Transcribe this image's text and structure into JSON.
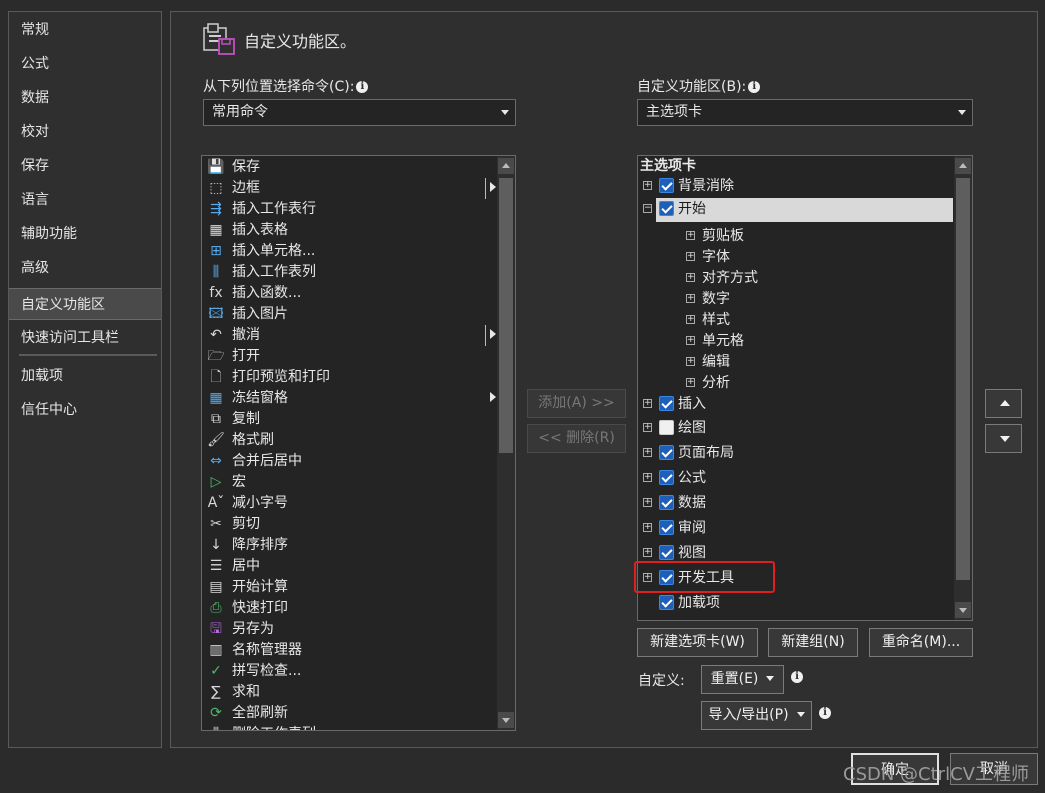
{
  "nav": {
    "items": [
      {
        "label": "常规"
      },
      {
        "label": "公式"
      },
      {
        "label": "数据"
      },
      {
        "label": "校对"
      },
      {
        "label": "保存"
      },
      {
        "label": "语言"
      },
      {
        "label": "辅助功能"
      },
      {
        "label": "高级"
      },
      {
        "label": "自定义功能区"
      },
      {
        "label": "快速访问工具栏"
      },
      {
        "label": "加载项"
      },
      {
        "label": "信任中心"
      }
    ],
    "selected_index": 8
  },
  "header": {
    "title": "自定义功能区。"
  },
  "left": {
    "label": "从下列位置选择命令(C):",
    "combo_value": "常用命令",
    "commands": [
      {
        "label": "保存",
        "icon": "save-icon",
        "glyph": "💾"
      },
      {
        "label": "边框",
        "icon": "border-icon",
        "glyph": "⬚",
        "submenu": true
      },
      {
        "label": "插入工作表行",
        "icon": "insert-row-icon",
        "glyph": "⇶"
      },
      {
        "label": "插入表格",
        "icon": "table-icon",
        "glyph": "▦"
      },
      {
        "label": "插入单元格...",
        "icon": "insert-cells-icon",
        "glyph": "⊞"
      },
      {
        "label": "插入工作表列",
        "icon": "insert-column-icon",
        "glyph": "⫼"
      },
      {
        "label": "插入函数...",
        "icon": "function-icon",
        "glyph": "fx"
      },
      {
        "label": "插入图片",
        "icon": "picture-icon",
        "glyph": "🖾"
      },
      {
        "label": "撤消",
        "icon": "undo-icon",
        "glyph": "↶",
        "submenu": true
      },
      {
        "label": "打开",
        "icon": "open-folder-icon",
        "glyph": "🗁"
      },
      {
        "label": "打印预览和打印",
        "icon": "print-preview-icon",
        "glyph": "🗋"
      },
      {
        "label": "冻结窗格",
        "icon": "freeze-panes-icon",
        "glyph": "▦",
        "submenu_arrow": true
      },
      {
        "label": "复制",
        "icon": "copy-icon",
        "glyph": "⧉"
      },
      {
        "label": "格式刷",
        "icon": "format-painter-icon",
        "glyph": "🖌"
      },
      {
        "label": "合并后居中",
        "icon": "merge-center-icon",
        "glyph": "⇔"
      },
      {
        "label": "宏",
        "icon": "macro-icon",
        "glyph": "▷"
      },
      {
        "label": "减小字号",
        "icon": "decrease-font-icon",
        "glyph": "Aˇ"
      },
      {
        "label": "剪切",
        "icon": "cut-icon",
        "glyph": "✂"
      },
      {
        "label": "降序排序",
        "icon": "sort-descending-icon",
        "glyph": "↓"
      },
      {
        "label": "居中",
        "icon": "align-center-icon",
        "glyph": "☰"
      },
      {
        "label": "开始计算",
        "icon": "calculator-icon",
        "glyph": "▤"
      },
      {
        "label": "快速打印",
        "icon": "quick-print-icon",
        "glyph": "⎙"
      },
      {
        "label": "另存为",
        "icon": "save-as-icon",
        "glyph": "🖫"
      },
      {
        "label": "名称管理器",
        "icon": "name-manager-icon",
        "glyph": "▥"
      },
      {
        "label": "拼写检查...",
        "icon": "spell-check-icon",
        "glyph": "✓"
      },
      {
        "label": "求和",
        "icon": "sum-icon",
        "glyph": "∑"
      },
      {
        "label": "全部刷新",
        "icon": "refresh-all-icon",
        "glyph": "⟳"
      },
      {
        "label": "删除工作表列",
        "icon": "delete-column-icon",
        "glyph": "⫼"
      }
    ]
  },
  "middle": {
    "add_label": "添加(A) >>",
    "remove_label": "<< 删除(R)"
  },
  "right": {
    "label": "自定义功能区(B):",
    "combo_value": "主选项卡",
    "tree_header": "主选项卡",
    "tree": [
      {
        "label": "背景消除",
        "level": 0,
        "expander": "+",
        "checked": true
      },
      {
        "label": "开始",
        "level": 0,
        "expander": "−",
        "checked": true,
        "selected": true
      },
      {
        "label": "剪贴板",
        "level": 1,
        "expander": "+"
      },
      {
        "label": "字体",
        "level": 1,
        "expander": "+"
      },
      {
        "label": "对齐方式",
        "level": 1,
        "expander": "+"
      },
      {
        "label": "数字",
        "level": 1,
        "expander": "+"
      },
      {
        "label": "样式",
        "level": 1,
        "expander": "+"
      },
      {
        "label": "单元格",
        "level": 1,
        "expander": "+"
      },
      {
        "label": "编辑",
        "level": 1,
        "expander": "+"
      },
      {
        "label": "分析",
        "level": 1,
        "expander": "+"
      },
      {
        "label": "插入",
        "level": 0,
        "expander": "+",
        "checked": true
      },
      {
        "label": "绘图",
        "level": 0,
        "expander": "+",
        "checked": false
      },
      {
        "label": "页面布局",
        "level": 0,
        "expander": "+",
        "checked": true
      },
      {
        "label": "公式",
        "level": 0,
        "expander": "+",
        "checked": true
      },
      {
        "label": "数据",
        "level": 0,
        "expander": "+",
        "checked": true
      },
      {
        "label": "审阅",
        "level": 0,
        "expander": "+",
        "checked": true
      },
      {
        "label": "视图",
        "level": 0,
        "expander": "+",
        "checked": true
      },
      {
        "label": "开发工具",
        "level": 0,
        "expander": "+",
        "checked": true,
        "highlighted": true
      },
      {
        "label": "加载项",
        "level": 0,
        "expander": "",
        "checked": true
      }
    ],
    "new_tab_label": "新建选项卡(W)",
    "new_group_label": "新建组(N)",
    "rename_label": "重命名(M)...",
    "customize_label": "自定义:",
    "reset_label": "重置(E)",
    "import_export_label": "导入/导出(P)"
  },
  "footer": {
    "ok_label": "确定",
    "cancel_label": "取消"
  },
  "watermark": "CSDN @CtrlCV工程师",
  "info_glyph": "i",
  "expander_glyph_plus": "+",
  "expander_glyph_minus": "−"
}
